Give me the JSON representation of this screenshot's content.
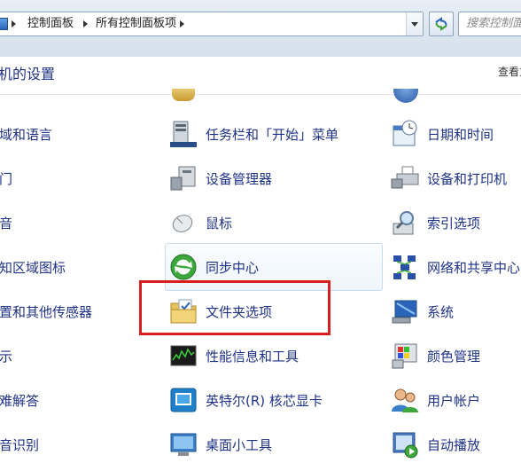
{
  "address": {
    "crumbs": [
      "控制面板",
      "所有控制面板项"
    ],
    "search_placeholder": "搜索控制面"
  },
  "header": {
    "title": "机的设置",
    "view_by": "查看方"
  },
  "left_column": [
    "域和语言",
    "门",
    "音",
    "知区域图标",
    "置和其他传感器",
    "示",
    "难解答",
    "音识别"
  ],
  "mid_column": [
    "任务栏和「开始」菜单",
    "设备管理器",
    "鼠标",
    "同步中心",
    "文件夹选项",
    "性能信息和工具",
    "英特尔(R) 核芯显卡",
    "桌面小工具"
  ],
  "right_column": [
    "日期和时间",
    "设备和打印机",
    "索引选项",
    "网络和共享中心",
    "系统",
    "颜色管理",
    "用户帐户",
    "自动播放"
  ],
  "icons": {
    "mid": [
      "taskbar-icon",
      "device-manager-icon",
      "mouse-icon",
      "sync-center-icon",
      "folder-options-icon",
      "performance-icon",
      "intel-graphics-icon",
      "gadgets-icon"
    ],
    "right": [
      "clock-calendar-icon",
      "printer-icon",
      "indexing-icon",
      "network-icon",
      "system-icon",
      "color-management-icon",
      "user-accounts-icon",
      "autoplay-icon"
    ]
  }
}
